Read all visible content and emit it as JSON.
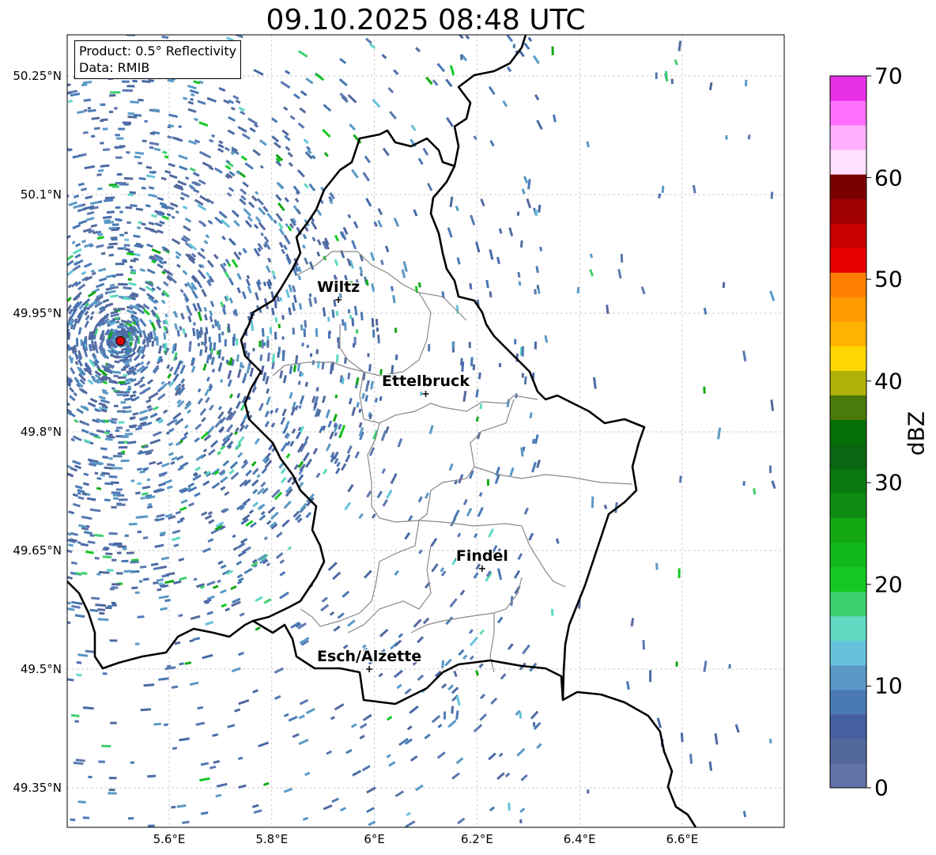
{
  "title": "09.10.2025 08:48 UTC",
  "info_box": {
    "product": "Product: 0.5° Reflectivity",
    "data_source": "Data: RMIB"
  },
  "map": {
    "type": "radar-reflectivity-map",
    "lon_range": [
      5.4,
      6.8
    ],
    "lat_range": [
      49.3,
      50.3
    ],
    "lat_ticks": [
      {
        "value": 50.25,
        "label": "50.25°N"
      },
      {
        "value": 50.1,
        "label": "50.1°N"
      },
      {
        "value": 49.95,
        "label": "49.95°N"
      },
      {
        "value": 49.8,
        "label": "49.8°N"
      },
      {
        "value": 49.65,
        "label": "49.65°N"
      },
      {
        "value": 49.5,
        "label": "49.5°N"
      },
      {
        "value": 49.35,
        "label": "49.35°N"
      }
    ],
    "lon_ticks": [
      {
        "value": 5.6,
        "label": "5.6°E"
      },
      {
        "value": 5.8,
        "label": "5.8°E"
      },
      {
        "value": 6.0,
        "label": "6°E"
      },
      {
        "value": 6.2,
        "label": "6.2°E"
      },
      {
        "value": 6.4,
        "label": "6.4°E"
      },
      {
        "value": 6.6,
        "label": "6.6°E"
      }
    ],
    "grid": true,
    "radar_site": {
      "lon": 5.505,
      "lat": 49.915
    },
    "cities": [
      {
        "name": "Wiltz",
        "lon": 5.93,
        "lat": 49.967
      },
      {
        "name": "Ettelbruck",
        "lon": 6.1,
        "lat": 49.848
      },
      {
        "name": "Findel",
        "lon": 6.21,
        "lat": 49.627
      },
      {
        "name": "Esch/Alzette",
        "lon": 5.99,
        "lat": 49.5
      }
    ]
  },
  "colorbar": {
    "label": "dBZ",
    "min": 0,
    "max": 70,
    "ticks": [
      {
        "value": 0,
        "label": "0"
      },
      {
        "value": 10,
        "label": "10"
      },
      {
        "value": 20,
        "label": "20"
      },
      {
        "value": 30,
        "label": "30"
      },
      {
        "value": 40,
        "label": "40"
      },
      {
        "value": 50,
        "label": "50"
      },
      {
        "value": 60,
        "label": "60"
      },
      {
        "value": 70,
        "label": "70"
      }
    ],
    "colors": [
      "#6272a8",
      "#53699e",
      "#455fa0",
      "#4a79b4",
      "#5a99c6",
      "#66c1da",
      "#60d8c2",
      "#3ecf6e",
      "#14c822",
      "#12b81a",
      "#12a814",
      "#0f8d12",
      "#0b7a0e",
      "#0a6610",
      "#057008",
      "#4a7a0a",
      "#b0b00a",
      "#ffd700",
      "#ffb400",
      "#ff9a00",
      "#ff7f00",
      "#e60000",
      "#c80000",
      "#a00000",
      "#7a0000",
      "#ffe0ff",
      "#ffb0ff",
      "#ff70ff",
      "#e830e8"
    ]
  }
}
